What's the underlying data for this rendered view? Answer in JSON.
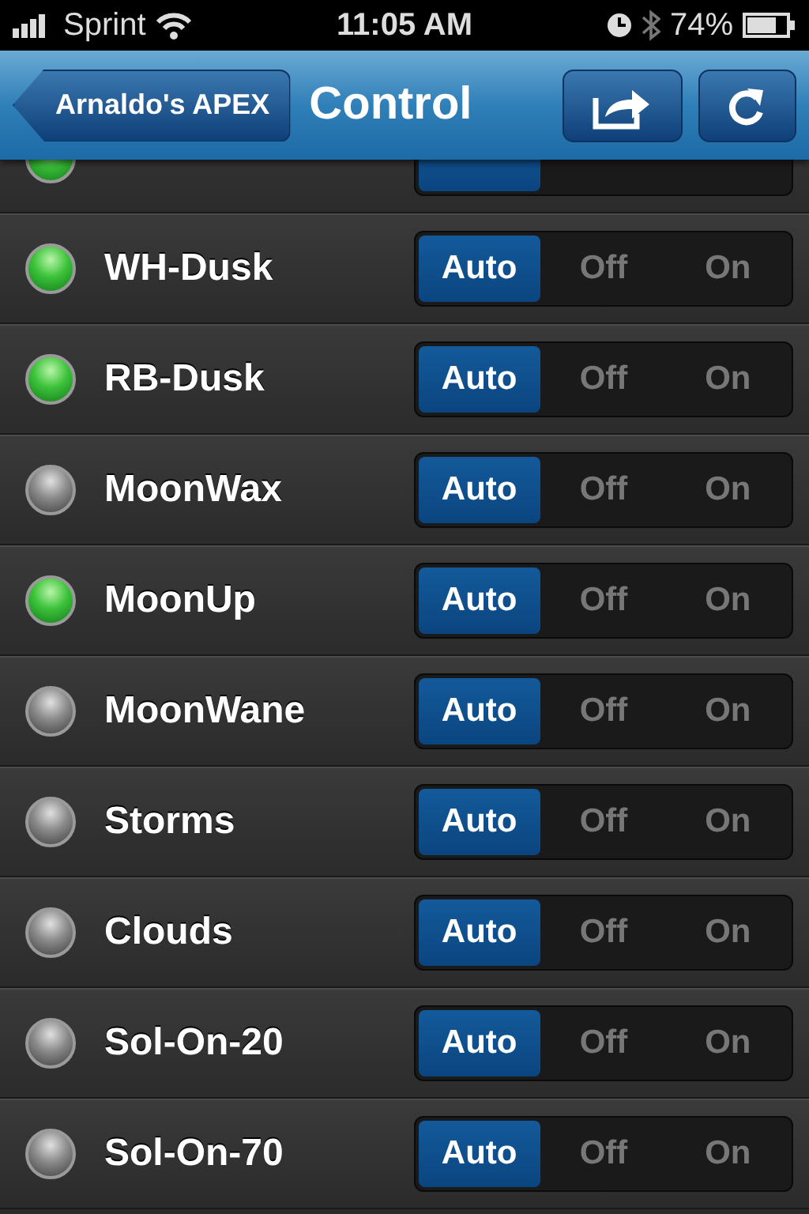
{
  "status_bar": {
    "carrier": "Sprint",
    "time": "11:05 AM",
    "battery": "74%"
  },
  "nav_bar": {
    "back": "Arnaldo's APEX",
    "title": "Control"
  },
  "outlets": [
    {
      "on": true,
      "modes": [
        {
          "selected": true
        },
        {
          "selected": false
        },
        {
          "selected": false
        }
      ]
    },
    {
      "name": "WH-Dusk",
      "on": true,
      "modes": [
        {
          "label": "Auto",
          "selected": true
        },
        {
          "label": "Off",
          "selected": false
        },
        {
          "label": "On",
          "selected": false
        }
      ]
    },
    {
      "name": "RB-Dusk",
      "on": true,
      "modes": [
        {
          "label": "Auto",
          "selected": true
        },
        {
          "label": "Off",
          "selected": false
        },
        {
          "label": "On",
          "selected": false
        }
      ]
    },
    {
      "name": "MoonWax",
      "on": false,
      "modes": [
        {
          "label": "Auto",
          "selected": true
        },
        {
          "label": "Off",
          "selected": false
        },
        {
          "label": "On",
          "selected": false
        }
      ]
    },
    {
      "name": "MoonUp",
      "on": true,
      "modes": [
        {
          "label": "Auto",
          "selected": true
        },
        {
          "label": "Off",
          "selected": false
        },
        {
          "label": "On",
          "selected": false
        }
      ]
    },
    {
      "name": "MoonWane",
      "on": false,
      "modes": [
        {
          "label": "Auto",
          "selected": true
        },
        {
          "label": "Off",
          "selected": false
        },
        {
          "label": "On",
          "selected": false
        }
      ]
    },
    {
      "name": "Storms",
      "on": false,
      "modes": [
        {
          "label": "Auto",
          "selected": true
        },
        {
          "label": "Off",
          "selected": false
        },
        {
          "label": "On",
          "selected": false
        }
      ]
    },
    {
      "name": "Clouds",
      "on": false,
      "modes": [
        {
          "label": "Auto",
          "selected": true
        },
        {
          "label": "Off",
          "selected": false
        },
        {
          "label": "On",
          "selected": false
        }
      ]
    },
    {
      "name": "Sol-On-20",
      "on": false,
      "modes": [
        {
          "label": "Auto",
          "selected": true
        },
        {
          "label": "Off",
          "selected": false
        },
        {
          "label": "On",
          "selected": false
        }
      ]
    },
    {
      "name": "Sol-On-70",
      "on": false,
      "modes": [
        {
          "label": "Auto",
          "selected": true
        },
        {
          "label": "Off",
          "selected": false
        },
        {
          "label": "On",
          "selected": false
        }
      ]
    }
  ]
}
